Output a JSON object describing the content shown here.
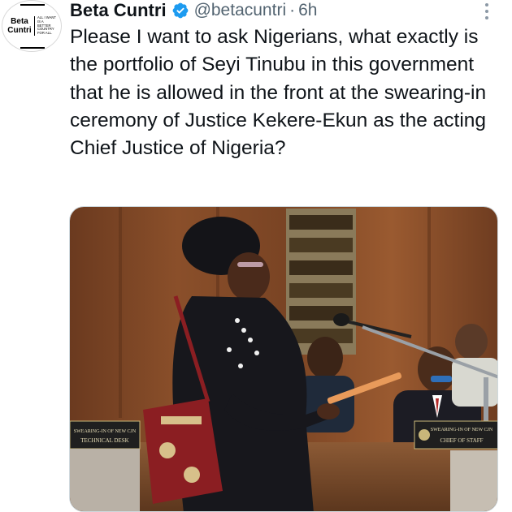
{
  "tweet": {
    "author": {
      "display_name": "Beta Cuntri",
      "handle": "@betacuntri",
      "verified": true,
      "avatar_logo": {
        "word": "Beta Cuntri",
        "motto": "All I want is a better country for all."
      }
    },
    "separator": "·",
    "time": "6h",
    "more_icon": "ellipsis-vertical-icon",
    "verified_icon": "verified-badge-icon",
    "text": "Please I want to ask Nigerians, what exactly is the portfolio of Seyi Tinubu in this government that he is allowed in the front at the swearing-in ceremony of Justice Kekere-Ekun as the acting Chief Justice of Nigeria?",
    "media": {
      "signs": {
        "left_line1": "SWEARING-IN OF NEW CJN",
        "left_line2": "TECHNICAL DESK",
        "right_line1": "SWEARING-IN OF NEW CJN",
        "right_line2": "CHIEF OF STAFF"
      }
    }
  },
  "colors": {
    "text": "#0f1419",
    "secondary": "#536471",
    "verified": "#1d9bf0",
    "border": "#cfd9de"
  }
}
